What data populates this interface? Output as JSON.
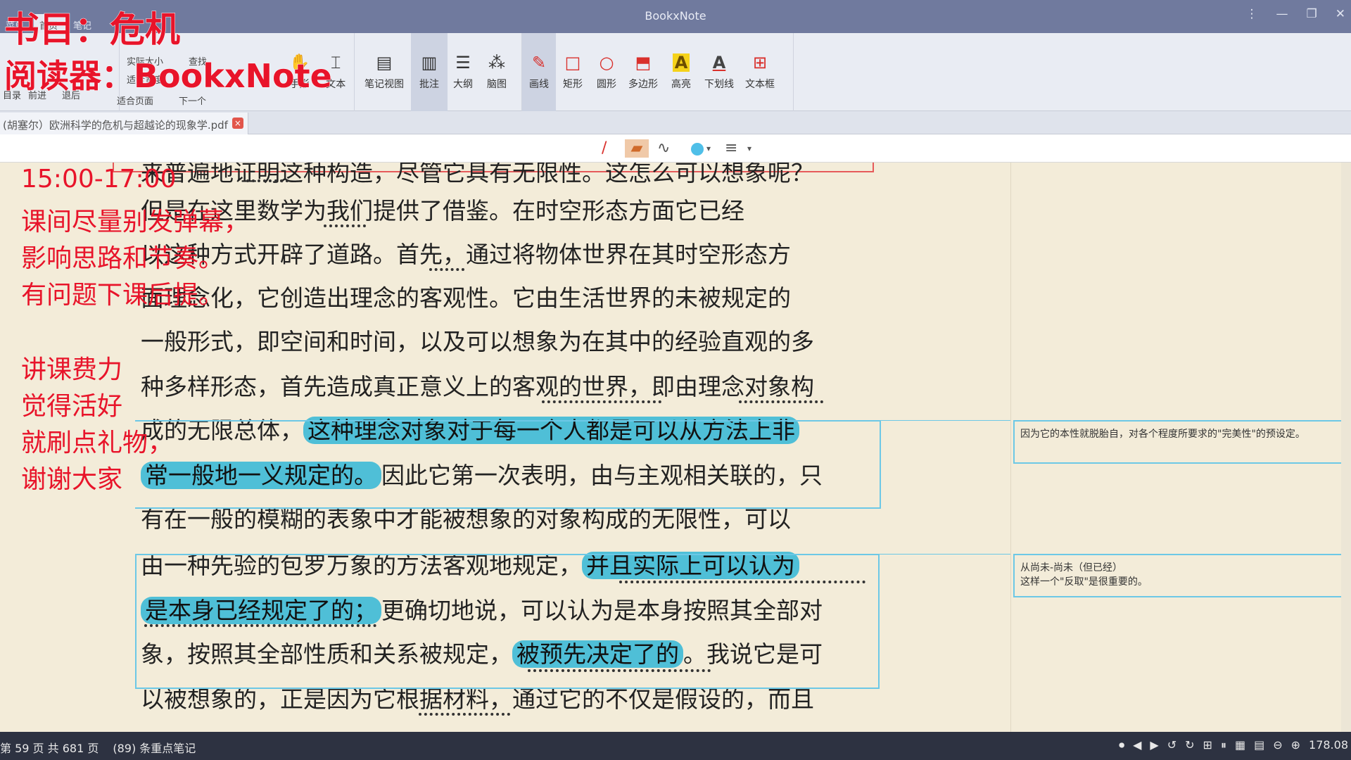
{
  "app": {
    "title": "BookxNote",
    "tabs": [
      "菜单",
      "首页",
      "笔记"
    ],
    "window_buttons": [
      "⋮",
      "—",
      "❐",
      "✕"
    ]
  },
  "toolbar": {
    "view_options": [
      "实际大小",
      "适合宽度",
      "适合页面"
    ],
    "nav": [
      "查找",
      "下一个"
    ],
    "left_tools": [
      "目录",
      "前进",
      "退后"
    ],
    "mode_tools": [
      {
        "label": "手形",
        "icon": "✋"
      },
      {
        "label": "文本",
        "icon": "⌶"
      }
    ],
    "view_tools": [
      {
        "label": "笔记视图",
        "icon": "▤"
      },
      {
        "label": "批注",
        "icon": "▥"
      },
      {
        "label": "大纲",
        "icon": "☰"
      },
      {
        "label": "脑图",
        "icon": "⁂"
      }
    ],
    "draw_tools": [
      {
        "label": "画线",
        "icon": "✎"
      },
      {
        "label": "矩形",
        "icon": "□"
      },
      {
        "label": "圆形",
        "icon": "○"
      },
      {
        "label": "多边形",
        "icon": "⬒"
      },
      {
        "label": "高亮",
        "icon": "A"
      },
      {
        "label": "下划线",
        "icon": "A"
      },
      {
        "label": "文本框",
        "icon": "⊞"
      }
    ]
  },
  "doc_tab": {
    "label": "(胡塞尔）欧洲科学的危机与超越论的现象学.pdf",
    "close": "×"
  },
  "drawbar": {
    "pen": "/",
    "marker": "▰",
    "curve": "∿",
    "color": "#4fbfe8",
    "lines": "≡"
  },
  "page": {
    "lines": [
      {
        "parts": [
          {
            "t": "来普遍地证明这种构造，尽管它具有无限性。这怎么可以想象呢？"
          }
        ]
      },
      {
        "parts": [
          {
            "t": "但是在这里数学为我们提供了借鉴。在时空形态方面它已经"
          }
        ]
      },
      {
        "parts": [
          {
            "t": "以这种方式开辟了道路。首先，通过将物体世界在其时空形态方"
          }
        ]
      },
      {
        "parts": [
          {
            "t": "面理念化，它创造出理念的客观性。它由生活世界的未被规定的"
          }
        ]
      },
      {
        "parts": [
          {
            "t": "一般形式，即空间和时间，以及可以想象为在其中的经验直观的多"
          }
        ]
      },
      {
        "parts": [
          {
            "t": "种多样形态，首先造成真正意义上的客观的世界，即由理念对象构"
          }
        ]
      },
      {
        "parts": [
          {
            "t": "成的无限总体，"
          },
          {
            "t": "这种理念对象对于每一个人都是可以从方法上非",
            "h": true
          }
        ]
      },
      {
        "parts": [
          {
            "t": "常一般地一义规定的。",
            "h": true
          },
          {
            "t": "因此它第一次表明，由与主观相关联的，只"
          }
        ]
      },
      {
        "parts": [
          {
            "t": "有在一般的模糊的表象中才能被想象的对象构成的无限性，可以"
          }
        ]
      },
      {
        "parts": [
          {
            "t": "由一种先验的包罗万象的方法客观地规定，"
          },
          {
            "t": "并且实际上可以认为",
            "h": true
          }
        ]
      },
      {
        "parts": [
          {
            "t": "是本身已经规定了的；",
            "h": true
          },
          {
            "t": "更确切地说，可以认为是本身按照其全部对"
          }
        ]
      },
      {
        "parts": [
          {
            "t": "象，按照其全部性质和关系被规定，"
          },
          {
            "t": "被预先决定了的",
            "h": true
          },
          {
            "t": "。我说它是可"
          }
        ]
      },
      {
        "parts": [
          {
            "t": "以被想象的，正是因为它根据材料，通过它的不仅是假设的，而且"
          }
        ]
      }
    ]
  },
  "notes": [
    {
      "text": "因为它的本性就脱胎自，对各个程度所要求的\"完美性\"的预设定。"
    },
    {
      "text": "从尚未-尚未（但已经）\n这样一个\"反取\"是很重要的。"
    }
  ],
  "overlay": {
    "book": "书目：危机",
    "reader": "阅读器：BookxNote",
    "time": "15:00-17:00",
    "notice": [
      "课间尽量别发弹幕，",
      "影响思路和节奏。",
      "有问题下课后提。"
    ],
    "thanks": [
      "讲课费力",
      "觉得活好",
      "就刷点礼物，",
      "谢谢大家"
    ],
    "color": "#e8142a"
  },
  "status": {
    "page_info": "第 59 页 共 681 页",
    "notes_count": "(89) 条重点笔记",
    "controls": [
      "⏺",
      "◀",
      "▶",
      "↺",
      "↻",
      "⊞",
      "⏸",
      "▦",
      "▤",
      "⊖",
      "⊕"
    ],
    "zoom": "178.08"
  }
}
